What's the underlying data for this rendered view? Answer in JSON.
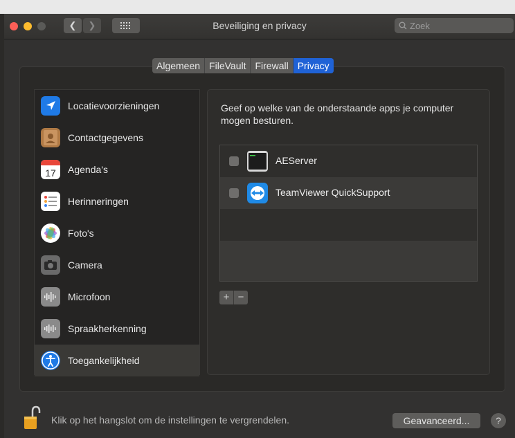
{
  "window": {
    "title": "Beveiliging en privacy",
    "search_placeholder": "Zoek"
  },
  "tabs": [
    {
      "label": "Algemeen",
      "active": false
    },
    {
      "label": "FileVault",
      "active": false
    },
    {
      "label": "Firewall",
      "active": false
    },
    {
      "label": "Privacy",
      "active": true
    }
  ],
  "sidebar": {
    "items": [
      {
        "label": "Locatievoorzieningen",
        "icon": "location-arrow-icon"
      },
      {
        "label": "Contactgegevens",
        "icon": "contacts-book-icon"
      },
      {
        "label": "Agenda's",
        "icon": "calendar-icon",
        "icon_text": "17"
      },
      {
        "label": "Herinneringen",
        "icon": "reminders-list-icon"
      },
      {
        "label": "Foto's",
        "icon": "photos-flower-icon"
      },
      {
        "label": "Camera",
        "icon": "camera-icon"
      },
      {
        "label": "Microfoon",
        "icon": "microphone-waveform-icon"
      },
      {
        "label": "Spraakherkenning",
        "icon": "speech-waveform-icon"
      },
      {
        "label": "Toegankelijkheid",
        "icon": "accessibility-icon",
        "selected": true
      }
    ]
  },
  "main": {
    "description": "Geef op welke van de onderstaande apps je computer mogen besturen.",
    "apps": [
      {
        "name": "AEServer",
        "checked": false,
        "icon": "terminal-icon"
      },
      {
        "name": "TeamViewer QuickSupport",
        "checked": false,
        "icon": "teamviewer-icon"
      }
    ],
    "add_label": "+",
    "remove_label": "−"
  },
  "footer": {
    "lock_text": "Klik op het hangslot om de instellingen te vergrendelen.",
    "advanced_label": "Geavanceerd...",
    "help_label": "?"
  },
  "colors": {
    "accent": "#1f62d6",
    "close": "#fd5f57",
    "minimize": "#febc2e",
    "zoom": "#5a5a58"
  }
}
